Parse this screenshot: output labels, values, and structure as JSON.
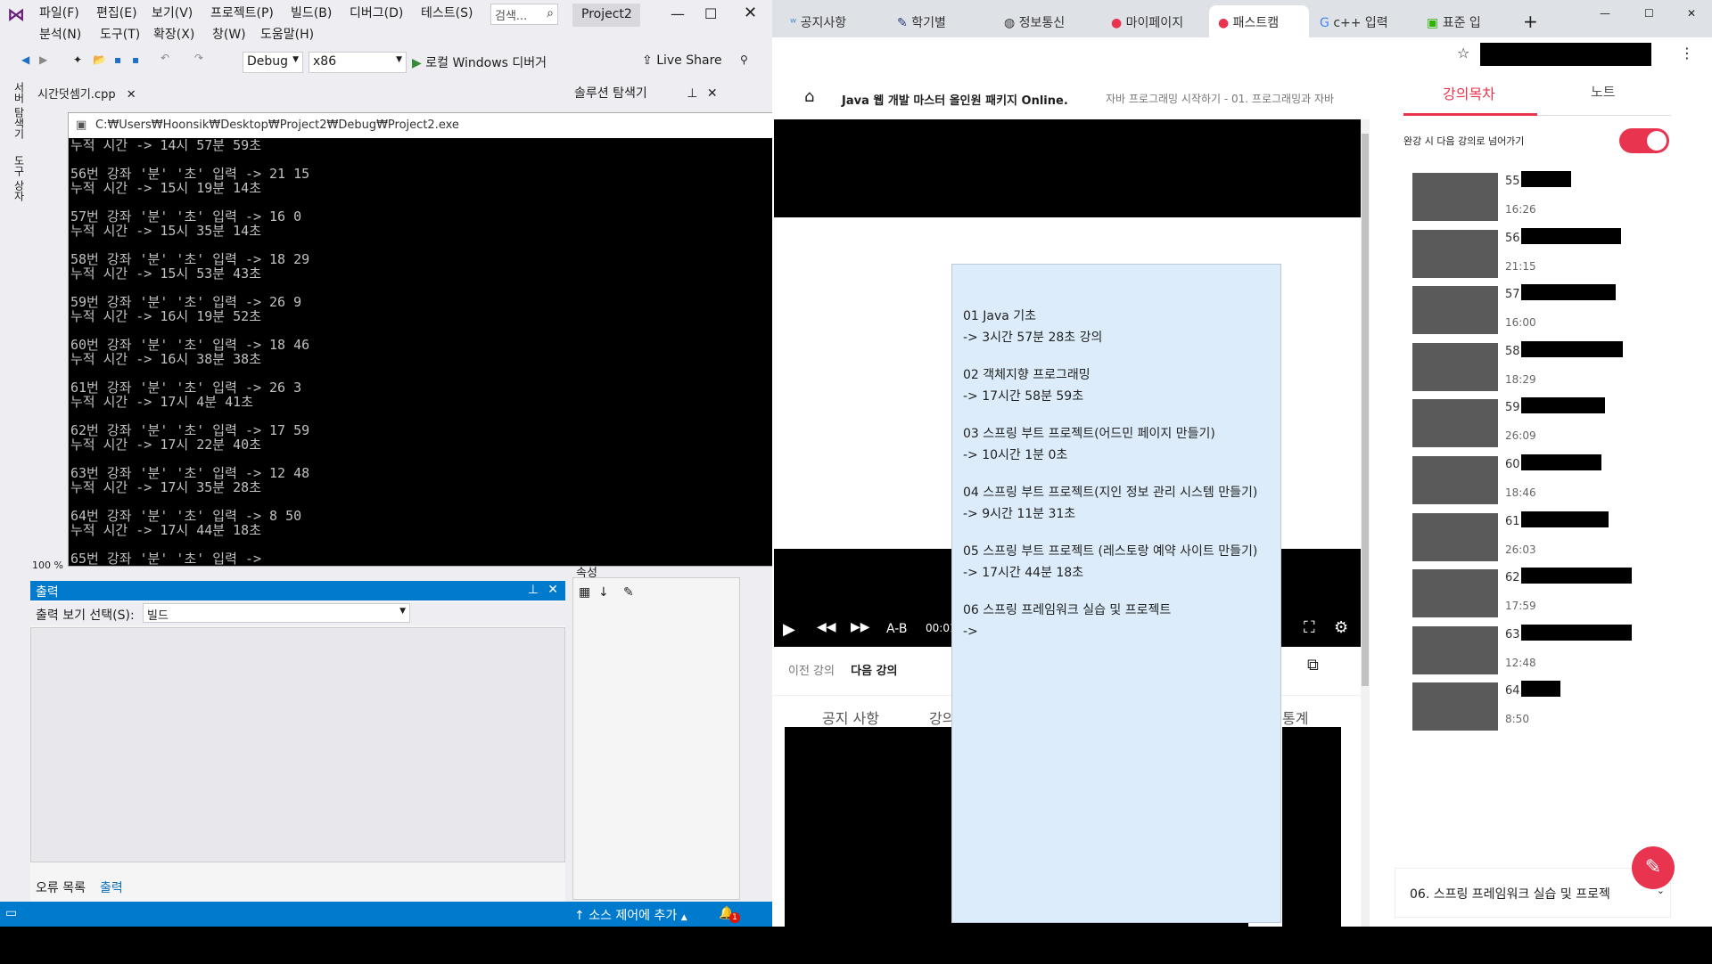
{
  "vs": {
    "menu": [
      "파일(F)",
      "편집(E)",
      "보기(V)",
      "프로젝트(P)",
      "빌드(B)",
      "디버그(D)",
      "테스트(S)",
      "분석(N)",
      "도구(T)",
      "확장(X)",
      "창(W)",
      "도움말(H)"
    ],
    "search_placeholder": "검색...",
    "project_name": "Project2",
    "toolbar": {
      "config": "Debug",
      "platform": "x86",
      "run_label": "로컬 Windows 디버거",
      "liveshare": "Live Share"
    },
    "doc_tab": "시간덧셈기.cpp",
    "solution_explorer": "솔루션 탐색기",
    "side_labels": [
      "서버 탐색기",
      "도구 상자"
    ],
    "zoom": "100 %",
    "properties_label": "속성",
    "output": {
      "title": "출력",
      "select_label": "출력 보기 선택(S):",
      "select_value": "빌드",
      "tabs": [
        "오류 목록",
        "출력"
      ]
    },
    "status": {
      "source_control": "소스 제어에 추가",
      "notif_count": "1"
    }
  },
  "console": {
    "title": "C:₩Users₩Hoonsik₩Desktop₩Project2₩Debug₩Project2.exe",
    "lines": [
      "누적 시간 -> 14시 57분 59초",
      "",
      "56번 강좌 '분' '초' 입력 -> 21 15",
      "누적 시간 -> 15시 19분 14초",
      "",
      "57번 강좌 '분' '초' 입력 -> 16 0",
      "누적 시간 -> 15시 35분 14초",
      "",
      "58번 강좌 '분' '초' 입력 -> 18 29",
      "누적 시간 -> 15시 53분 43초",
      "",
      "59번 강좌 '분' '초' 입력 -> 26 9",
      "누적 시간 -> 16시 19분 52초",
      "",
      "60번 강좌 '분' '초' 입력 -> 18 46",
      "누적 시간 -> 16시 38분 38초",
      "",
      "61번 강좌 '분' '초' 입력 -> 26 3",
      "누적 시간 -> 17시 4분 41초",
      "",
      "62번 강좌 '분' '초' 입력 -> 17 59",
      "누적 시간 -> 17시 22분 40초",
      "",
      "63번 강좌 '분' '초' 입력 -> 12 48",
      "누적 시간 -> 17시 35분 28초",
      "",
      "64번 강좌 '분' '초' 입력 -> 8 50",
      "누적 시간 -> 17시 44분 18초",
      "",
      "65번 강좌 '분' '초' 입력 ->"
    ]
  },
  "chrome": {
    "tabs": [
      "공지사항",
      "학기별",
      "정보통신",
      "마이페이지",
      "패스트캠",
      "c++ 입력",
      "표준 입"
    ],
    "course_title": "Java 웹 개발 마스터 올인원 패키지 Online.",
    "breadcrumb": "자바 프로그래밍 시작하기 - 01. 프로그래밍과 자바",
    "player": {
      "ab": "A-B",
      "time": "00:01"
    },
    "nav": {
      "prev": "이전 강의",
      "next": "다음 강의"
    },
    "section_tabs": [
      "공지 사항",
      "강의",
      "통계"
    ]
  },
  "notes": [
    {
      "title": "01 Java 기초",
      "time": "-> 3시간 57분 28초 강의"
    },
    {
      "title": "02 객체지향 프로그래밍",
      "time": "-> 17시간 58분 59초"
    },
    {
      "title": "03 스프링 부트 프로젝트(어드민 페이지 만들기)",
      "time": "-> 10시간 1분 0초"
    },
    {
      "title": "04 스프링 부트 프로젝트(지인 정보 관리 시스템 만들기)",
      "time": "-> 9시간 11분 31초"
    },
    {
      "title": "05 스프링 부트 프로젝트 (레스토랑 예약 사이트 만들기)",
      "time": "-> 17시간 44분 18초"
    },
    {
      "title": "06 스프링 프레임워크 실습 및 프로젝트",
      "time": "->"
    }
  ],
  "rpanel": {
    "tabs": [
      "강의목차",
      "노트"
    ],
    "autoplay_label": "완강 시 다음 강의로 넘어가기",
    "items": [
      {
        "num": "55.",
        "dur": "16:26"
      },
      {
        "num": "56.",
        "dur": "21:15"
      },
      {
        "num": "57.",
        "dur": "16:00"
      },
      {
        "num": "58.",
        "dur": "18:29"
      },
      {
        "num": "59.",
        "dur": "26:09"
      },
      {
        "num": "60",
        "dur": "18:46"
      },
      {
        "num": "61",
        "dur": "26:03"
      },
      {
        "num": "62",
        "dur": "17:59"
      },
      {
        "num": "63",
        "dur": "12:48"
      },
      {
        "num": "64.",
        "dur": "8:50"
      }
    ],
    "section_footer": "06. 스프링 프레임워크 실습 및 프로젝"
  },
  "colors": {
    "vs_blue": "#007acc",
    "accent_red": "#e8344e",
    "notes_bg": "#dcecfb"
  }
}
